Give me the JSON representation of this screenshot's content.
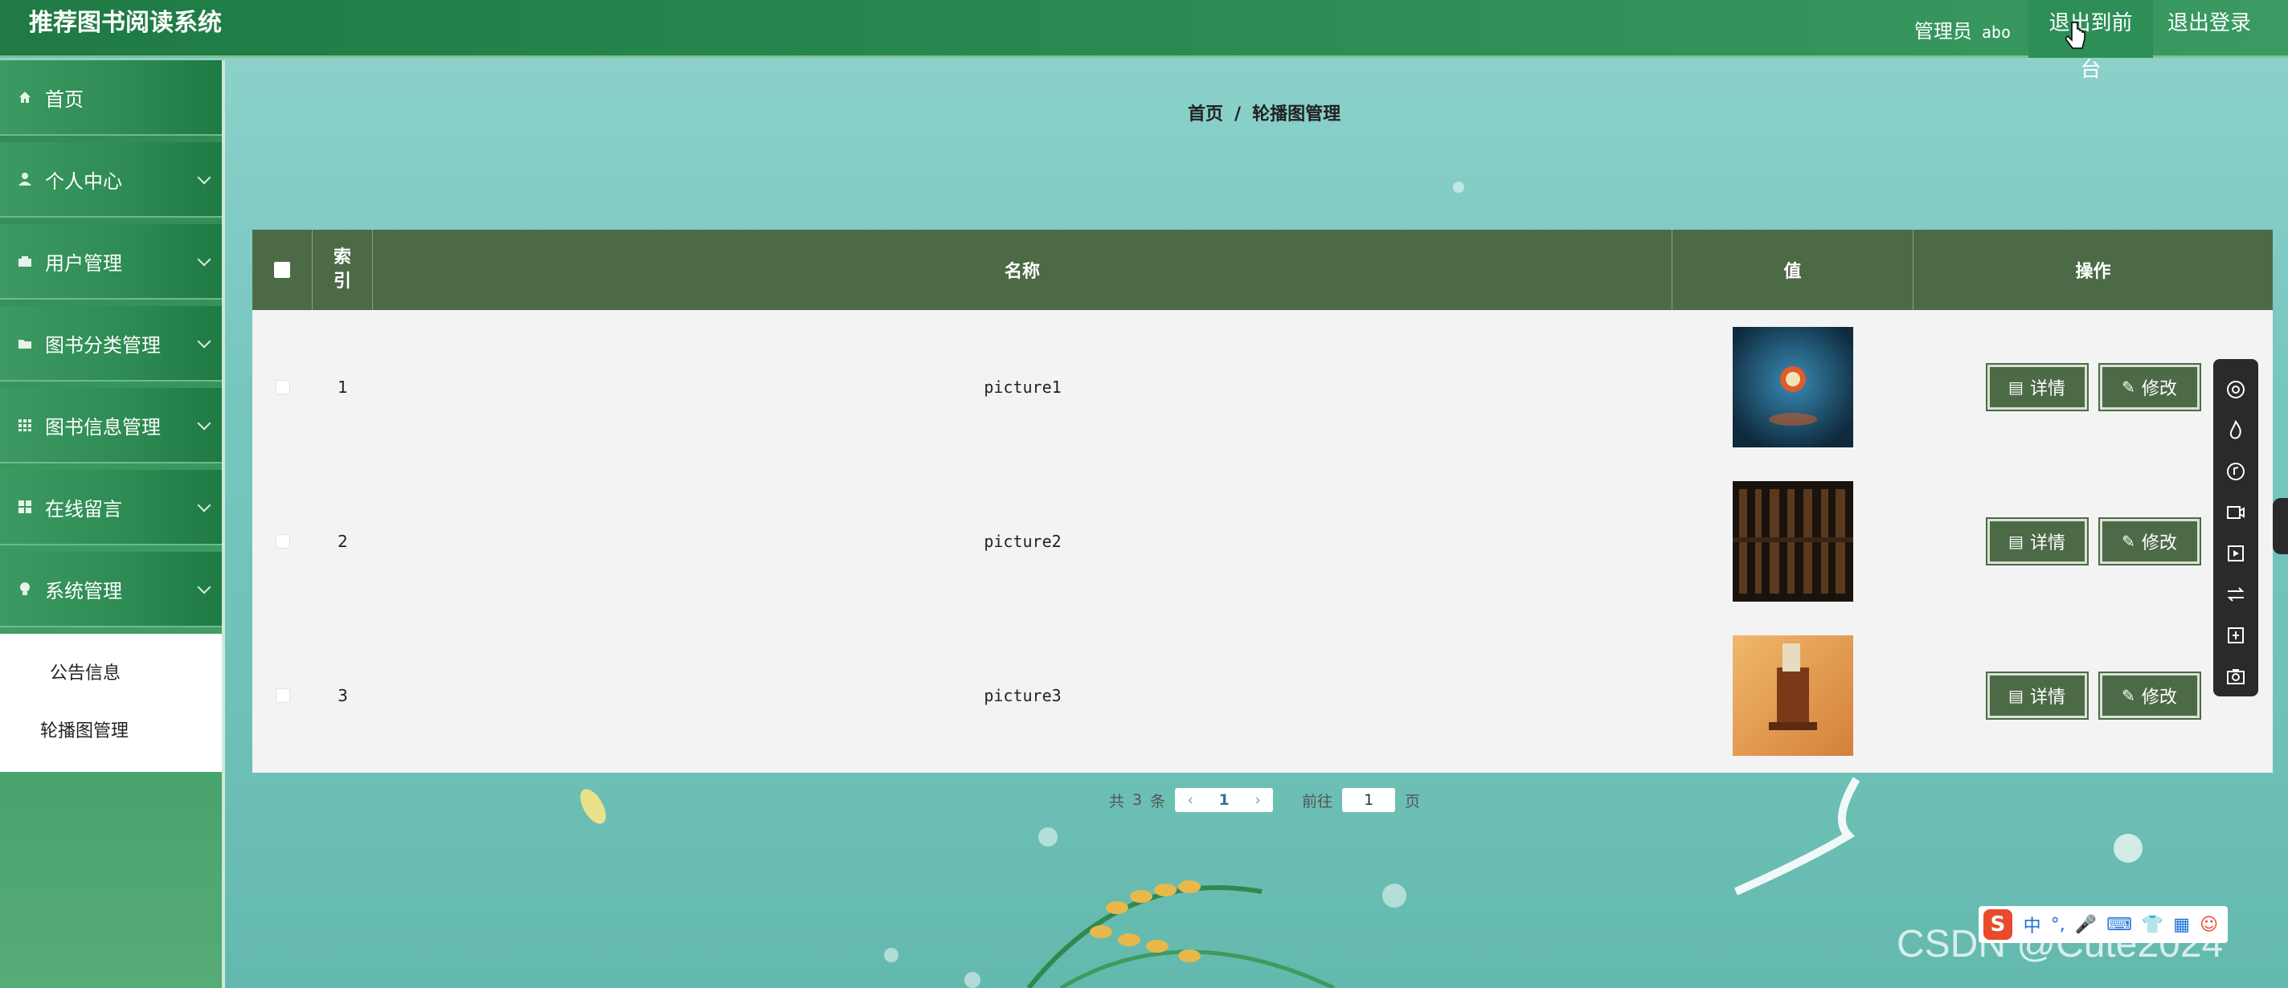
{
  "header": {
    "brand": "推荐图书阅读系统",
    "admin_label": "管理员",
    "admin_name": "abo",
    "front_button": "退出到前台",
    "logout_button": "退出登录"
  },
  "sidebar": {
    "items": [
      {
        "label": "首页",
        "icon": "home-icon"
      },
      {
        "label": "个人中心",
        "icon": "user-icon"
      },
      {
        "label": "用户管理",
        "icon": "users-icon"
      },
      {
        "label": "图书分类管理",
        "icon": "folder-icon"
      },
      {
        "label": "图书信息管理",
        "icon": "grid-icon"
      },
      {
        "label": "在线留言",
        "icon": "apps-icon"
      },
      {
        "label": "系统管理",
        "icon": "bulb-icon"
      }
    ],
    "subitems": [
      {
        "label": "公告信息"
      },
      {
        "label": "轮播图管理"
      }
    ]
  },
  "breadcrumb": {
    "home": "首页",
    "separator": "/",
    "current": "轮播图管理"
  },
  "table": {
    "headers": {
      "index": "索引",
      "name": "名称",
      "value": "值",
      "ops": "操作"
    },
    "rows": [
      {
        "index": "1",
        "name": "picture1"
      },
      {
        "index": "2",
        "name": "picture2"
      },
      {
        "index": "3",
        "name": "picture3"
      }
    ],
    "detail_button": "详情",
    "edit_button": "修改"
  },
  "pager": {
    "total_prefix": "共",
    "total_count": "3",
    "total_suffix": "条",
    "current_page": "1",
    "goto_prefix": "前往",
    "goto_value": "1",
    "goto_suffix": "页"
  },
  "ime": {
    "logo": "S",
    "mode": "中",
    "punct": "°,"
  },
  "watermark": "CSDN @Cute2024",
  "colors": {
    "header_green": "#2a8a52",
    "table_header": "#4d6a47",
    "button_bg": "#4d6a47"
  }
}
